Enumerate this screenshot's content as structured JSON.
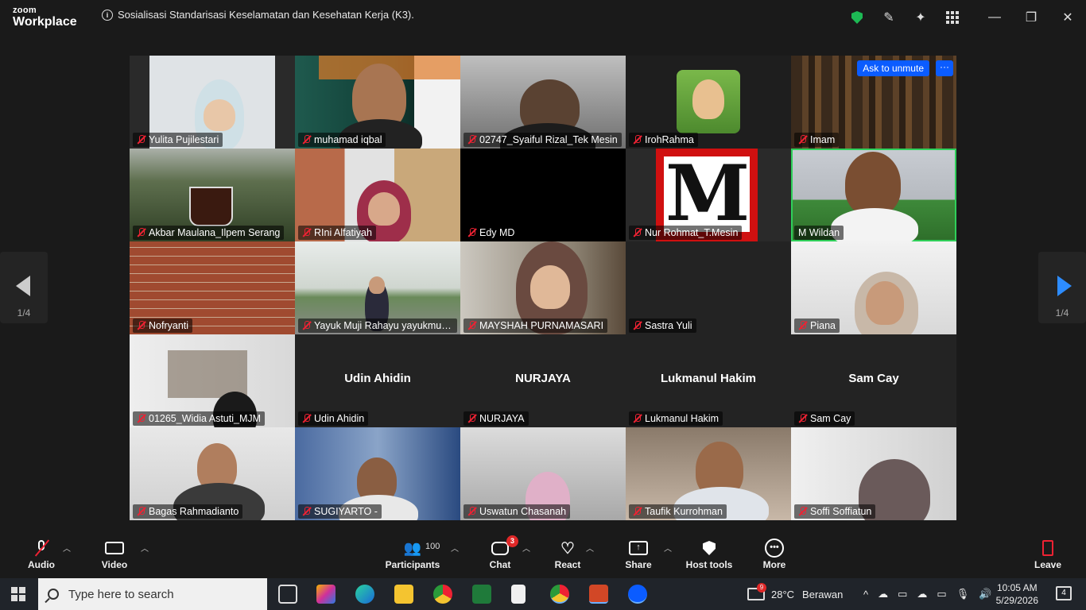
{
  "app": {
    "logo_top": "zoom",
    "logo_bottom": "Workplace",
    "meeting_title": "Sosialisasi Standarisasi Keselamatan dan Kesehatan Kerja (K3)."
  },
  "gallery": {
    "ask_unmute": "Ask to unmute",
    "more": "···",
    "participants": [
      {
        "name": "Yulita Pujilestari"
      },
      {
        "name": "muhamad iqbal"
      },
      {
        "name": "02747_Syaiful Rizal_Tek Mesin"
      },
      {
        "name": "IrohRahma"
      },
      {
        "name": "Imam"
      },
      {
        "name": "Akbar Maulana_Ilpem Serang"
      },
      {
        "name": "RIni Alfatiyah"
      },
      {
        "name": "Edy MD"
      },
      {
        "name": "Nur Rohmat_T.Mesin"
      },
      {
        "name": "M Wildan"
      },
      {
        "name": "Nofryanti"
      },
      {
        "name": "Yayuk Muji Rahayu yayukmuji..."
      },
      {
        "name": "MAYSHAH PURNAMASARI"
      },
      {
        "name": "Sastra Yuli"
      },
      {
        "name": "Piana"
      },
      {
        "name": "01265_Widia Astuti_MJM"
      },
      {
        "name": "Udin Ahidin",
        "center": "Udin Ahidin"
      },
      {
        "name": "NURJAYA",
        "center": "NURJAYA"
      },
      {
        "name": "Lukmanul Hakim",
        "center": "Lukmanul Hakim"
      },
      {
        "name": "Sam Cay",
        "center": "Sam Cay"
      },
      {
        "name": "Bagas Rahmadianto"
      },
      {
        "name": "SUGIYARTO -"
      },
      {
        "name": "Uswatun Chasanah"
      },
      {
        "name": "Taufik Kurrohman"
      },
      {
        "name": "Soffi Soffiatun"
      }
    ]
  },
  "pager": {
    "left": "1/4",
    "right": "1/4"
  },
  "toolbar": {
    "audio": "Audio",
    "video": "Video",
    "participants": "Participants",
    "participants_count": "100",
    "chat": "Chat",
    "chat_badge": "3",
    "react": "React",
    "share": "Share",
    "host_tools": "Host tools",
    "more": "More",
    "leave": "Leave"
  },
  "taskbar": {
    "search_placeholder": "Type here to search",
    "weather_badge": "9",
    "temp": "28°C",
    "weather": "Berawan",
    "time": "10:05 AM",
    "date": "5/29/2026",
    "notif_count": "4"
  }
}
